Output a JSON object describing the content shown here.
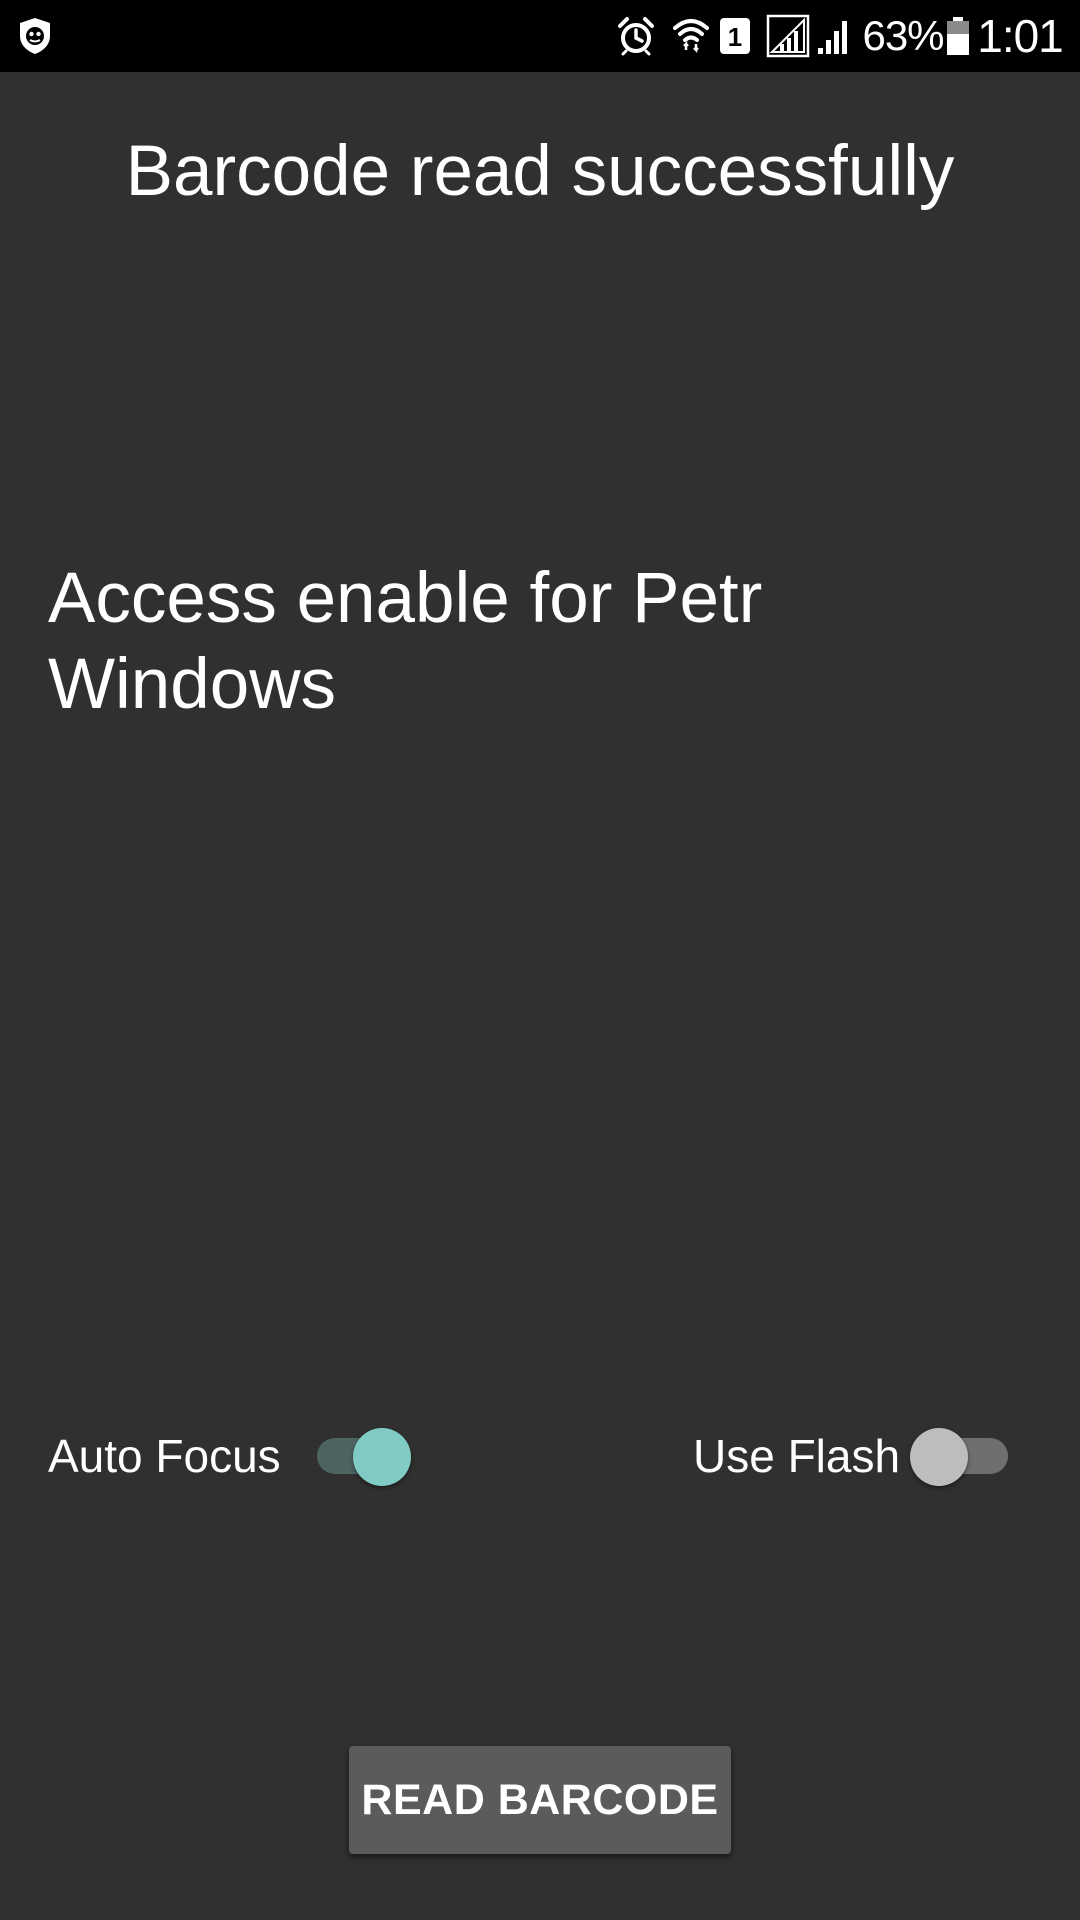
{
  "status_bar": {
    "left_icon": "shield-app-icon",
    "icons": [
      "alarm-icon",
      "wifi-icon",
      "sim-1-icon",
      "signal-icon",
      "signal-icon"
    ],
    "battery_percent": "63%",
    "battery_level": 0.63,
    "time": "1:01"
  },
  "main": {
    "title": "Barcode read successfully",
    "message": "Access enable for Petr\nWindows"
  },
  "options": {
    "auto_focus": {
      "label": "Auto Focus",
      "checked": true
    },
    "use_flash": {
      "label": "Use Flash",
      "checked": false
    }
  },
  "actions": {
    "read_barcode_label": "READ BARCODE"
  },
  "colors": {
    "background": "#303030",
    "status_bar": "#000000",
    "switch_on_thumb": "#80cbc4",
    "switch_on_track": "#4e6461",
    "switch_off_thumb": "#bdbdbd",
    "switch_off_track": "#6f6f6f",
    "button": "#5b5b5b"
  }
}
